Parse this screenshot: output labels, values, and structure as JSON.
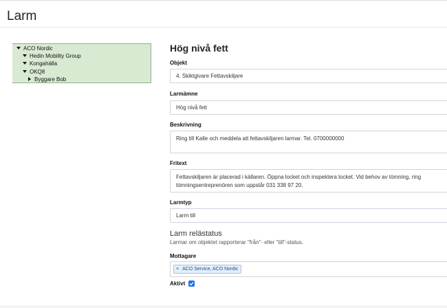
{
  "page": {
    "title": "Larm"
  },
  "tree": {
    "nodes": [
      {
        "label": "ACO Nordic",
        "expanded": true
      },
      {
        "label": "Hedin Mobility Group",
        "expanded": true
      },
      {
        "label": "Kongahälla",
        "expanded": true
      },
      {
        "label": "OKQ8",
        "expanded": true
      },
      {
        "label": "Byggare Bob",
        "expanded": false
      }
    ]
  },
  "form": {
    "title": "Hög nivå fett",
    "objekt": {
      "label": "Objekt",
      "value": "4. Skiktgivare Fettavskiljare"
    },
    "larmamne": {
      "label": "Larmämne",
      "value": "Hög nivå fett"
    },
    "beskrivning": {
      "label": "Beskrivning",
      "value": "Ring till Kalle och meddela att fettavskiljaren larmar. Tel. 0700000000"
    },
    "fritext": {
      "label": "Fritext",
      "value": "Fettavskiljaren är placerad i källaren. Öppna locket och inspektera locket. Vid behov av tömning, ring tömningsentreprenören som uppstår 031 338 97 20."
    },
    "larmtyp": {
      "label": "Larmtyp",
      "value": "Larm till"
    },
    "relastatus": {
      "title": "Larm relästatus",
      "description": "Larmar om objektet rapporterar \"från\"- eller \"till\"-status."
    },
    "mottagare": {
      "label": "Mottagare",
      "tags": [
        "ACO Service, ACO Nordic"
      ],
      "remove_symbol": "×"
    },
    "aktivt": {
      "label": "Aktivt",
      "checked": true
    }
  },
  "colors": {
    "tree_bg": "#d9ead3",
    "tree_border": "#8fb08a",
    "checkbox": "#1a73e8",
    "tag_bg": "#e4eef9"
  }
}
